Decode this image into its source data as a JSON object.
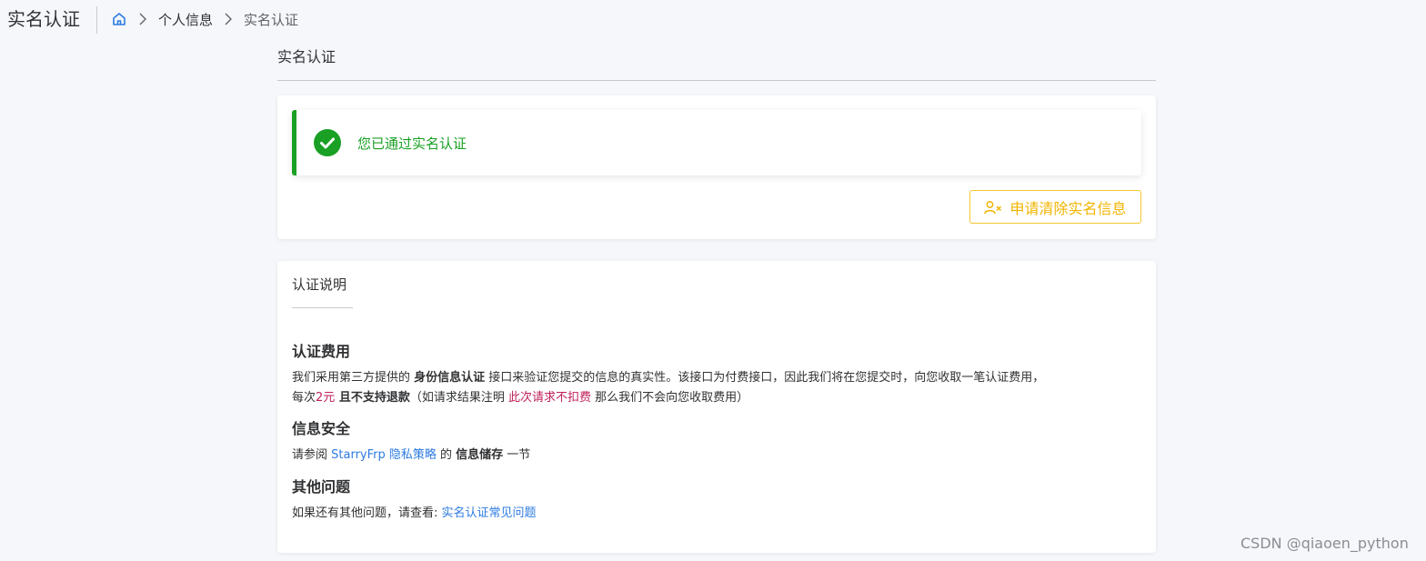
{
  "header": {
    "title": "实名认证",
    "breadcrumb": [
      "个人信息",
      "实名认证"
    ]
  },
  "section": {
    "title": "实名认证"
  },
  "status": {
    "message": "您已通过实名认证",
    "clear_button": "申请清除实名信息"
  },
  "info": {
    "tab": "认证说明",
    "fee": {
      "heading": "认证费用",
      "line1_a": "我们采用第三方提供的 ",
      "line1_b": "身份信息认证",
      "line1_c": " 接口来验证您提交的信息的真实性。该接口为付费接口，因此我们将在您提交时，向您收取一笔认证费用，",
      "line2_a": "每次",
      "line2_price": "2元",
      "line2_b": " 且不支持退款",
      "line2_c": "（如请求结果注明 ",
      "line2_note": "此次请求不扣费",
      "line2_d": " 那么我们不会向您收取费用）"
    },
    "security": {
      "heading": "信息安全",
      "a": "请参阅 ",
      "link": "StarryFrp 隐私策略",
      "b": " 的 ",
      "c": "信息储存",
      "d": " 一节"
    },
    "other": {
      "heading": "其他问题",
      "a": "如果还有其他问题，请查看: ",
      "link": "实名认证常见问题"
    }
  },
  "watermark": "CSDN @qiaoen_python",
  "colors": {
    "success": "#1aa024",
    "warning": "#f0b400",
    "link": "#2d7be0",
    "highlight": "#c01f5b"
  }
}
